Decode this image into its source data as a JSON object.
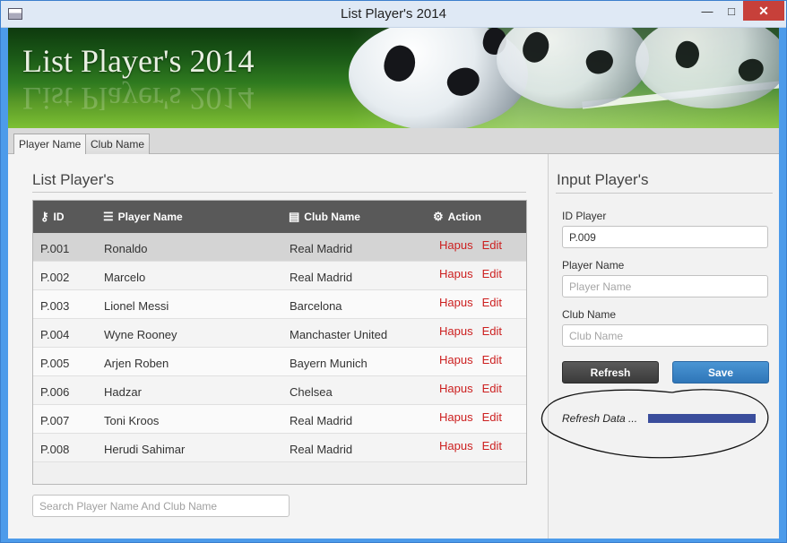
{
  "window": {
    "title": "List Player's 2014",
    "min_icon": "minimize-icon",
    "max_icon": "maximize-icon",
    "close_icon": "close-icon"
  },
  "banner": {
    "title": "List Player's 2014"
  },
  "tabs": [
    {
      "label": "Player Name",
      "active": true
    },
    {
      "label": "Club Name",
      "active": false
    }
  ],
  "list": {
    "title": "List Player's",
    "columns": [
      {
        "label": "ID",
        "icon": "key-icon"
      },
      {
        "label": "Player Name",
        "icon": "list-icon"
      },
      {
        "label": "Club Name",
        "icon": "book-icon"
      },
      {
        "label": "Action",
        "icon": "gear-icon"
      }
    ],
    "rows": [
      {
        "id": "P.001",
        "name": "Ronaldo",
        "club": "Real Madrid",
        "hapus": "Hapus",
        "edit": "Edit"
      },
      {
        "id": "P.002",
        "name": "Marcelo",
        "club": "Real Madrid",
        "hapus": "Hapus",
        "edit": "Edit"
      },
      {
        "id": "P.003",
        "name": "Lionel Messi",
        "club": "Barcelona",
        "hapus": "Hapus",
        "edit": "Edit"
      },
      {
        "id": "P.004",
        "name": "Wyne Rooney",
        "club": "Manchaster United",
        "hapus": "Hapus",
        "edit": "Edit"
      },
      {
        "id": "P.005",
        "name": "Arjen Roben",
        "club": "Bayern Munich",
        "hapus": "Hapus",
        "edit": "Edit"
      },
      {
        "id": "P.006",
        "name": "Hadzar",
        "club": "Chelsea",
        "hapus": "Hapus",
        "edit": "Edit"
      },
      {
        "id": "P.007",
        "name": "Toni Kroos",
        "club": "Real Madrid",
        "hapus": "Hapus",
        "edit": "Edit"
      },
      {
        "id": "P.008",
        "name": "Herudi Sahimar",
        "club": "Real Madrid",
        "hapus": "Hapus",
        "edit": "Edit"
      }
    ],
    "search_placeholder": "Search Player Name And Club Name"
  },
  "form": {
    "title": "Input Player's",
    "id_label": "ID Player",
    "id_value": "P.009",
    "name_label": "Player Name",
    "name_placeholder": "Player Name",
    "club_label": "Club Name",
    "club_placeholder": "Club Name",
    "refresh_label": "Refresh",
    "save_label": "Save",
    "status_text": "Refresh Data ...",
    "progress": 1.0
  },
  "colors": {
    "accent": "#2f76b8",
    "action_link": "#cc1f1f",
    "progress": "#3a4d9c",
    "header": "#595959"
  }
}
